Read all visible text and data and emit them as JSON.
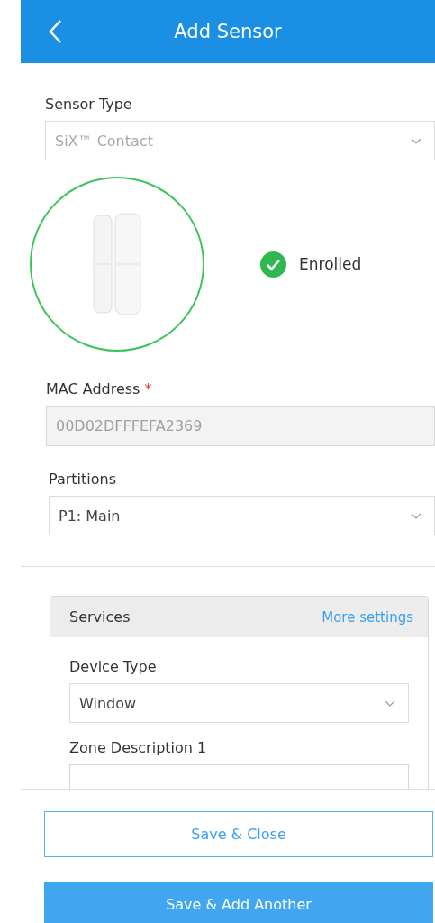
{
  "header": {
    "title": "Add Sensor"
  },
  "sensor_type": {
    "label": "Sensor Type",
    "value": "SiX™ Contact",
    "disabled": true
  },
  "status": {
    "text": "Enrolled"
  },
  "mac_address": {
    "label": "MAC Address",
    "required_mark": "*",
    "value": "00D02DFFFEFA2369",
    "disabled": true
  },
  "partitions": {
    "label": "Partitions",
    "value": "P1: Main",
    "disabled": false
  },
  "services": {
    "title": "Services",
    "link": "More settings",
    "device_type": {
      "label": "Device Type",
      "value": "Window"
    },
    "zone_description": {
      "label": "Zone Description 1"
    }
  },
  "buttons": [
    {
      "label": "Save & Close",
      "kind": "outline"
    },
    {
      "label": "Save & Add Another",
      "kind": "filled"
    }
  ]
}
